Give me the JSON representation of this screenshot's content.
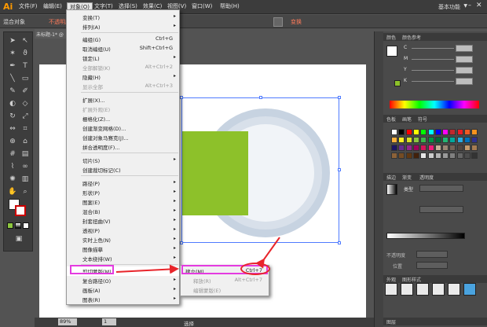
{
  "app": {
    "logo": "Ai",
    "workspace": "基本功能"
  },
  "menubar": {
    "items": [
      "文件(F)",
      "编辑(E)",
      "对象(O)",
      "文字(T)",
      "选择(S)",
      "效果(C)",
      "视图(V)",
      "窗口(W)",
      "帮助(H)"
    ]
  },
  "controlbar": {
    "mixed_objects": "混合对象",
    "opacity": "不透明度",
    "transform": "变换"
  },
  "document": {
    "tab_label": "未标题-1* @"
  },
  "object_menu": {
    "items": [
      {
        "label": "变换(T)",
        "shortcut": "",
        "submenu": true,
        "disabled": false
      },
      {
        "label": "排列(A)",
        "shortcut": "",
        "submenu": true,
        "disabled": false
      },
      {
        "label": "编组(G)",
        "shortcut": "Ctrl+G",
        "submenu": false,
        "disabled": false
      },
      {
        "label": "取消编组(U)",
        "shortcut": "Shift+Ctrl+G",
        "submenu": false,
        "disabled": false
      },
      {
        "label": "锁定(L)",
        "shortcut": "",
        "submenu": true,
        "disabled": false
      },
      {
        "label": "全部解锁(K)",
        "shortcut": "Alt+Ctrl+2",
        "submenu": false,
        "disabled": true
      },
      {
        "label": "隐藏(H)",
        "shortcut": "",
        "submenu": true,
        "disabled": false
      },
      {
        "label": "显示全部",
        "shortcut": "Alt+Ctrl+3",
        "submenu": false,
        "disabled": true
      },
      {
        "label": "扩展(X)...",
        "shortcut": "",
        "submenu": false,
        "disabled": false
      },
      {
        "label": "扩展外观(E)",
        "shortcut": "",
        "submenu": false,
        "disabled": true
      },
      {
        "label": "栅格化(Z)...",
        "shortcut": "",
        "submenu": false,
        "disabled": false
      },
      {
        "label": "创建渐变网格(D)...",
        "shortcut": "",
        "submenu": false,
        "disabled": false
      },
      {
        "label": "创建对象马赛克(J)...",
        "shortcut": "",
        "submenu": false,
        "disabled": false
      },
      {
        "label": "拼合透明度(F)...",
        "shortcut": "",
        "submenu": false,
        "disabled": false
      },
      {
        "label": "切片(S)",
        "shortcut": "",
        "submenu": true,
        "disabled": false
      },
      {
        "label": "创建裁切标记(C)",
        "shortcut": "",
        "submenu": false,
        "disabled": false
      },
      {
        "label": "路径(P)",
        "shortcut": "",
        "submenu": true,
        "disabled": false
      },
      {
        "label": "形状(P)",
        "shortcut": "",
        "submenu": true,
        "disabled": false
      },
      {
        "label": "图案(E)",
        "shortcut": "",
        "submenu": true,
        "disabled": false
      },
      {
        "label": "混合(B)",
        "shortcut": "",
        "submenu": true,
        "disabled": false
      },
      {
        "label": "封套扭曲(V)",
        "shortcut": "",
        "submenu": true,
        "disabled": false
      },
      {
        "label": "透视(P)",
        "shortcut": "",
        "submenu": true,
        "disabled": false
      },
      {
        "label": "实时上色(N)",
        "shortcut": "",
        "submenu": true,
        "disabled": false
      },
      {
        "label": "图像描摹",
        "shortcut": "",
        "submenu": true,
        "disabled": false
      },
      {
        "label": "文本绕排(W)",
        "shortcut": "",
        "submenu": true,
        "disabled": false
      },
      {
        "label": "剪切蒙版(M)",
        "shortcut": "",
        "submenu": true,
        "disabled": false
      },
      {
        "label": "复合路径(O)",
        "shortcut": "",
        "submenu": true,
        "disabled": false
      },
      {
        "label": "画板(A)",
        "shortcut": "",
        "submenu": true,
        "disabled": false
      },
      {
        "label": "图表(R)",
        "shortcut": "",
        "submenu": true,
        "disabled": false
      }
    ]
  },
  "clipping_submenu": {
    "items": [
      {
        "label": "建立(M)",
        "shortcut": "Ctrl+7",
        "disabled": false
      },
      {
        "label": "释放(R)",
        "shortcut": "Alt+Ctrl+7",
        "disabled": true
      },
      {
        "label": "编辑蒙版(E)",
        "shortcut": "",
        "disabled": true
      }
    ]
  },
  "panels": {
    "color_tabs": [
      "颜色",
      "颜色参考"
    ],
    "cmyk": [
      "C",
      "M",
      "Y",
      "K"
    ],
    "swatch_tabs": [
      "色板",
      "画笔",
      "符号"
    ],
    "gradient_tabs": [
      "描边",
      "渐变",
      "透明度"
    ],
    "gradient_type": "类型",
    "opacity_label": "不透明度",
    "position_label": "位置",
    "appearance_tabs": [
      "外观",
      "图形样式"
    ],
    "layers_tab": "图层"
  },
  "statusbar": {
    "zoom": "89%",
    "page": "1",
    "status": "选择"
  },
  "colors": {
    "green_rect": "#8dc12a",
    "highlight": "#e43be0",
    "arrow": "#e8252b",
    "selection": "#4f7bff"
  }
}
